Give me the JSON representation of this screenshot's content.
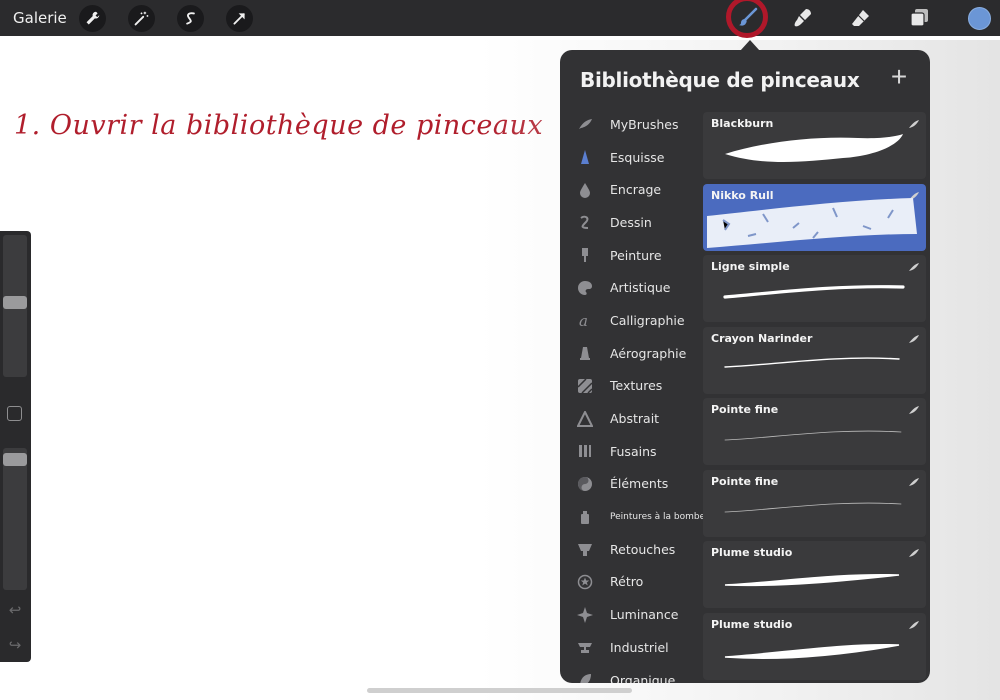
{
  "toolbar": {
    "gallery_label": "Galerie",
    "left_tools": [
      "wrench-icon",
      "magic-wand-icon",
      "selection-icon",
      "transform-arrow-icon"
    ],
    "right_tools": [
      "brush-icon",
      "smudge-icon",
      "eraser-icon",
      "layers-icon"
    ],
    "color_swatch": "#6b96d6",
    "highlight_color": "#b0182a"
  },
  "annotation": {
    "text": "1. Ouvrir la bibliothèque de pinceaux",
    "color": "#b01e2c"
  },
  "panel": {
    "title": "Bibliothèque de pinceaux",
    "add_label": "+",
    "categories": [
      {
        "label": "MyBrushes",
        "icon": "feather-icon"
      },
      {
        "label": "Esquisse",
        "icon": "pencil-tip-icon"
      },
      {
        "label": "Encrage",
        "icon": "ink-drop-icon"
      },
      {
        "label": "Dessin",
        "icon": "squiggle-icon"
      },
      {
        "label": "Peinture",
        "icon": "paintbrush-icon"
      },
      {
        "label": "Artistique",
        "icon": "palette-icon"
      },
      {
        "label": "Calligraphie",
        "icon": "calligraphy-a-icon"
      },
      {
        "label": "Aérographie",
        "icon": "airbrush-icon"
      },
      {
        "label": "Textures",
        "icon": "texture-icon"
      },
      {
        "label": "Abstrait",
        "icon": "triangle-icon"
      },
      {
        "label": "Fusains",
        "icon": "charcoal-icon"
      },
      {
        "label": "Éléments",
        "icon": "yin-yang-icon"
      },
      {
        "label": "Peintures à la bombe",
        "icon": "spray-can-icon"
      },
      {
        "label": "Retouches",
        "icon": "retouch-icon"
      },
      {
        "label": "Rétro",
        "icon": "star-circle-icon"
      },
      {
        "label": "Luminance",
        "icon": "sparkle-icon"
      },
      {
        "label": "Industriel",
        "icon": "anvil-icon"
      },
      {
        "label": "Organique",
        "icon": "leaf-icon"
      }
    ],
    "brushes": [
      {
        "name": "Blackburn",
        "selected": false
      },
      {
        "name": "Nikko Rull",
        "selected": true
      },
      {
        "name": "Ligne simple",
        "selected": false
      },
      {
        "name": "Crayon Narinder",
        "selected": false
      },
      {
        "name": "Pointe fine",
        "selected": false
      },
      {
        "name": "Pointe fine",
        "selected": false
      },
      {
        "name": "Plume studio",
        "selected": false
      },
      {
        "name": "Plume studio",
        "selected": false
      }
    ]
  },
  "sidebar": {
    "brush_size_level": 0.53,
    "opacity_level": 0.96
  }
}
